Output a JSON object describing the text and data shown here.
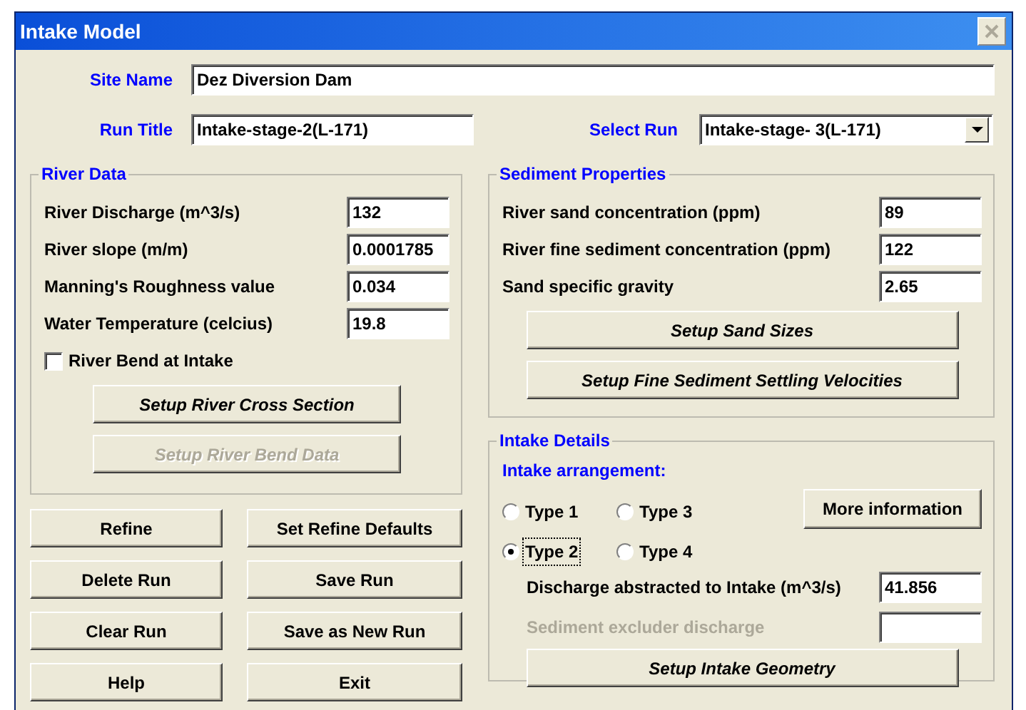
{
  "window": {
    "title": "Intake Model"
  },
  "site_name": {
    "label": "Site Name",
    "value": "Dez Diversion Dam"
  },
  "run_title": {
    "label": "Run Title",
    "value": "Intake-stage-2(L-171)"
  },
  "select_run": {
    "label": "Select Run",
    "value": "Intake-stage- 3(L-171)"
  },
  "river_data": {
    "title": "River Data",
    "fields": [
      {
        "label": "River Discharge  (m^3/s)",
        "value": "132"
      },
      {
        "label": "River slope (m/m)",
        "value": "0.0001785"
      },
      {
        "label": "Manning's Roughness value",
        "value": "0.034"
      },
      {
        "label": "Water Temperature (celcius)",
        "value": "19.8"
      }
    ],
    "checkbox": {
      "label": "River Bend at Intake",
      "checked": false
    },
    "buttons": [
      {
        "label": "Setup River Cross Section",
        "disabled": false
      },
      {
        "label": "Setup River Bend Data",
        "disabled": true
      }
    ]
  },
  "actions": [
    {
      "label": "Refine"
    },
    {
      "label": "Set Refine Defaults"
    },
    {
      "label": "Delete Run"
    },
    {
      "label": "Save Run"
    },
    {
      "label": "Clear Run"
    },
    {
      "label": "Save as New Run"
    },
    {
      "label": "Help"
    },
    {
      "label": "Exit"
    }
  ],
  "sediment_properties": {
    "title": "Sediment Properties",
    "fields": [
      {
        "label": "River sand concentration (ppm)",
        "value": "89"
      },
      {
        "label": "River fine sediment concentration (ppm)",
        "value": "122"
      },
      {
        "label": "Sand specific gravity",
        "value": "2.65"
      }
    ],
    "buttons": [
      {
        "label": "Setup Sand Sizes",
        "disabled": false
      },
      {
        "label": "Setup Fine Sediment Settling Velocities",
        "disabled": false
      }
    ]
  },
  "intake_details": {
    "title": "Intake Details",
    "subtitle": "Intake arrangement:",
    "types": [
      {
        "label": "Type 1",
        "selected": false,
        "focused": false
      },
      {
        "label": "Type 3",
        "selected": false,
        "focused": false
      },
      {
        "label": "Type 2",
        "selected": true,
        "focused": true
      },
      {
        "label": "Type 4",
        "selected": false,
        "focused": false
      }
    ],
    "more_info": "More information",
    "fields": [
      {
        "label": "Discharge abstracted to Intake  (m^3/s)",
        "value": "41.856",
        "disabled": false
      },
      {
        "label": "Sediment excluder discharge",
        "disabled": true
      }
    ],
    "buttons": [
      {
        "label": "Setup Intake Geometry",
        "disabled": false
      }
    ]
  }
}
